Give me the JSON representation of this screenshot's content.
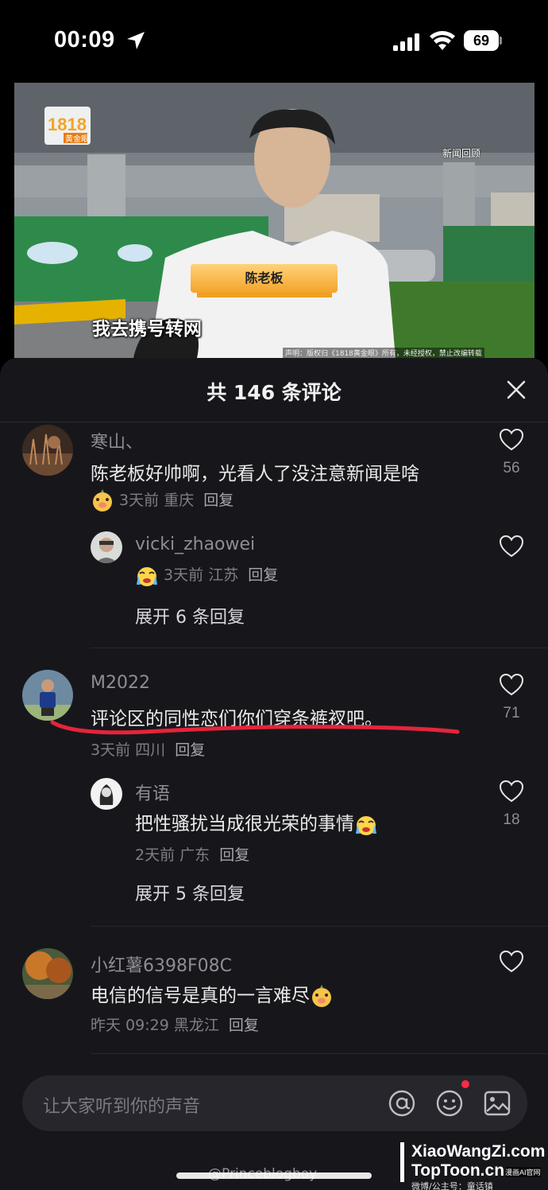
{
  "status_bar": {
    "time": "00:09",
    "battery": "69",
    "icons": [
      "location-arrow-icon",
      "signal-icon",
      "wifi-icon",
      "battery-icon"
    ]
  },
  "video": {
    "subtitle": "我去携号转网",
    "nameplate": "陈老板",
    "news_tag": "新闻回顾",
    "copyright": "声明：版权归《1818黄金眼》所有，未经授权，禁止改编转载",
    "logo_text": "1818",
    "logo_sub": "黄金眼"
  },
  "sheet": {
    "title": "共 146 条评论"
  },
  "comments": [
    {
      "user": "寒山、",
      "text": "陈老板好帅啊，光看人了没注意新闻是啥",
      "meta_time": "3天前",
      "meta_location": "重庆",
      "reply_label": "回复",
      "likes": "56"
    },
    {
      "user": "vicki_zhaowei",
      "text": "",
      "meta_time": "3天前",
      "meta_location": "江苏",
      "reply_label": "回复",
      "likes": ""
    },
    {
      "expand": "展开 6 条回复"
    },
    {
      "user": "M2022",
      "text": "评论区的同性恋们你们穿条裤衩吧。",
      "meta_time": "3天前",
      "meta_location": "四川",
      "reply_label": "回复",
      "likes": "71"
    },
    {
      "user": "有语",
      "text": "把性骚扰当成很光荣的事情",
      "meta_time": "2天前",
      "meta_location": "广东",
      "reply_label": "回复",
      "likes": "18"
    },
    {
      "expand": "展开 5 条回复"
    },
    {
      "user": "小红薯6398F08C",
      "text": "电信的信号是真的一言难尽",
      "meta_time": "昨天 09:29",
      "meta_location": "黑龙江",
      "reply_label": "回复",
      "likes": ""
    }
  ],
  "input": {
    "placeholder": "让大家听到你的声音"
  },
  "watermark": {
    "handle": "@Princeblogboy",
    "site1": "XiaoWangZi.com",
    "site2": "TopToon.cn",
    "tag": "漫画AI官网",
    "line3": "微博/公主号：童话镇"
  },
  "colors": {
    "sheet_bg": "#17171b",
    "accent_red": "#ff2b45",
    "underline_red": "#e5243b"
  }
}
